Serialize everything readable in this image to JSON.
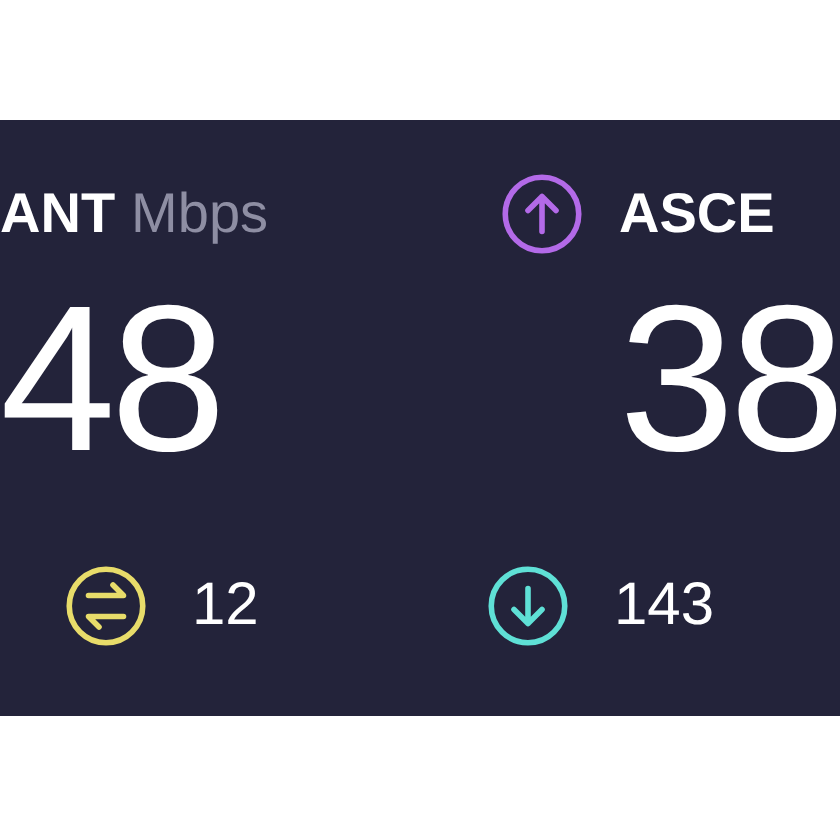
{
  "metrics": [
    {
      "label": "ANT",
      "unit": "Mbps",
      "value": "48"
    },
    {
      "kind": "upload",
      "label": "ASCE",
      "value": "38",
      "color": "#b36ae8"
    }
  ],
  "details": [
    {
      "kind": "jitter",
      "value": "12",
      "color": "#e8dc6a"
    },
    {
      "kind": "download",
      "value": "143",
      "color": "#5fe0d6"
    }
  ]
}
